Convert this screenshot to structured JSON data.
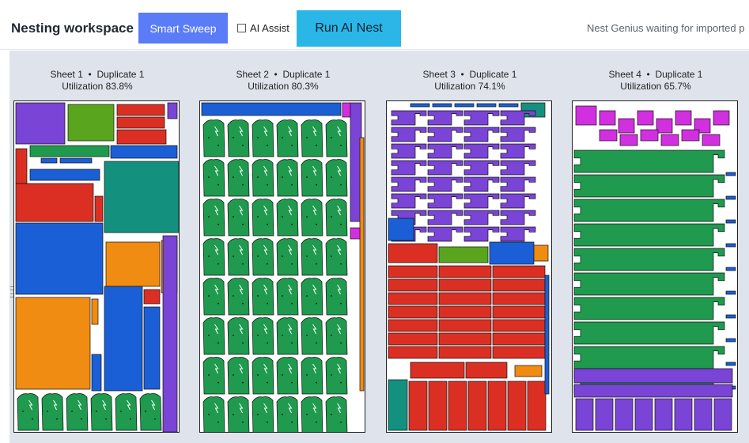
{
  "header": {
    "title": "Nesting workspace",
    "smart_sweep_label": "Smart Sweep",
    "ai_assist_label": "AI Assist",
    "ai_assist_checked": false,
    "run_label": "Run AI Nest",
    "status_text": "Nest Genius waiting for imported p"
  },
  "colors": {
    "green": "#1f9a4e",
    "purple": "#7a44d6",
    "red": "#dc2f24",
    "blue": "#1b5fd6",
    "teal": "#14907e",
    "orange": "#f08c12",
    "magenta": "#d22fe0",
    "olive": "#5aa51e",
    "run_button": "#2bb6e8",
    "sweep_button": "#5b7cf7"
  },
  "sheets": [
    {
      "name": "Sheet 1",
      "duplicate": "Duplicate 1",
      "utilization": "Utilization 83.8%"
    },
    {
      "name": "Sheet 2",
      "duplicate": "Duplicate 1",
      "utilization": "Utilization 80.3%"
    },
    {
      "name": "Sheet 3",
      "duplicate": "Duplicate 1",
      "utilization": "Utilization 74.1%"
    },
    {
      "name": "Sheet 4",
      "duplicate": "Duplicate 1",
      "utilization": "Utilization 65.7%"
    }
  ]
}
